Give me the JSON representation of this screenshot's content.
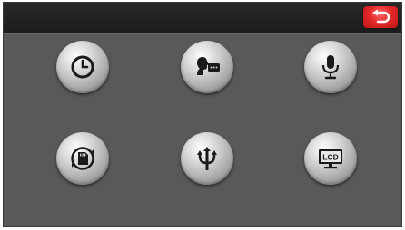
{
  "icons": {
    "back": "back-arrow-icon",
    "clock": "clock-icon",
    "speech": "speech-icon",
    "mic": "microphone-icon",
    "storage": "memory-card-sync-icon",
    "usb": "usb-icon",
    "lcd": "lcd-monitor-icon"
  },
  "lcd_label": "LCD",
  "colors": {
    "screen_bg": "#58595b",
    "topbar_bg": "#1f1f1f",
    "back_button": "#e52a2a"
  }
}
